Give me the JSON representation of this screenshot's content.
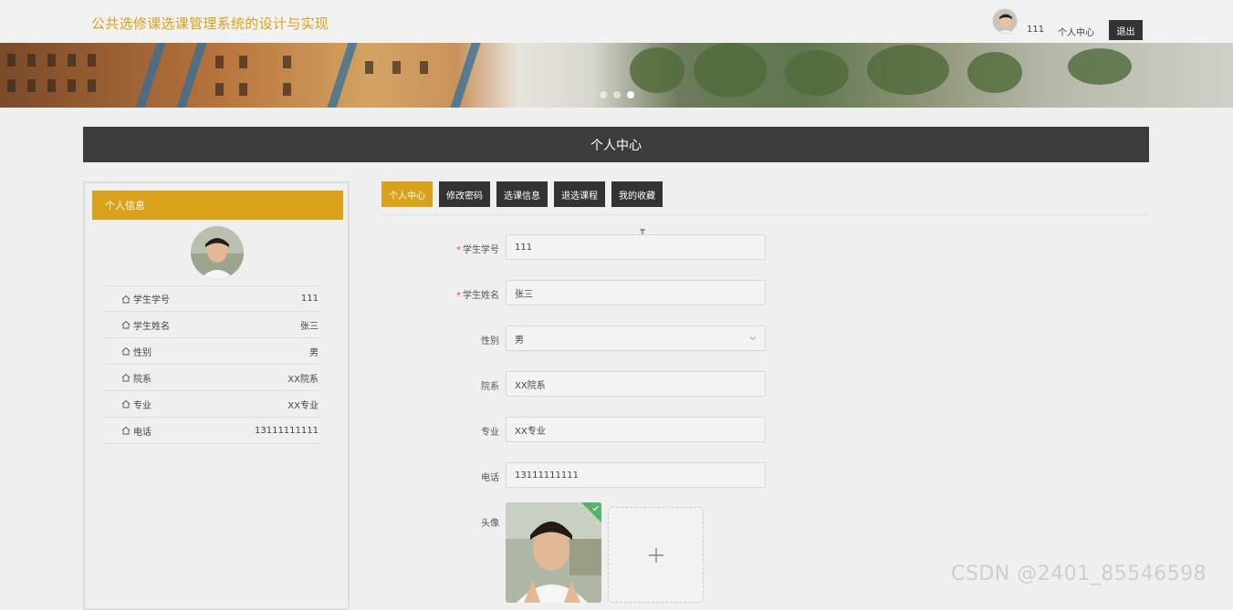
{
  "header": {
    "site_title": "公共选修课选课管理系统的设计与实现",
    "username": "111",
    "profile_link": "个人中心",
    "logout_label": "退出"
  },
  "banner": {
    "slide_count": 3,
    "active_slide": 3
  },
  "page_title": "个人中心",
  "sidebar": {
    "heading": "个人信息",
    "items": [
      {
        "label": "学生学号",
        "value": "111",
        "icon": "home-icon"
      },
      {
        "label": "学生姓名",
        "value": "张三",
        "icon": "home-icon"
      },
      {
        "label": "性别",
        "value": "男",
        "icon": "home-icon"
      },
      {
        "label": "院系",
        "value": "XX院系",
        "icon": "home-icon"
      },
      {
        "label": "专业",
        "value": "XX专业",
        "icon": "home-icon"
      },
      {
        "label": "电话",
        "value": "13111111111",
        "icon": "home-icon"
      }
    ]
  },
  "tabs": [
    {
      "label": "个人中心",
      "active": true
    },
    {
      "label": "修改密码",
      "active": false
    },
    {
      "label": "选课信息",
      "active": false
    },
    {
      "label": "退选课程",
      "active": false
    },
    {
      "label": "我的收藏",
      "active": false
    }
  ],
  "form": {
    "student_id": {
      "label": "学生学号",
      "value": "111",
      "required": true
    },
    "student_name": {
      "label": "学生姓名",
      "value": "张三",
      "required": true
    },
    "gender": {
      "label": "性别",
      "value": "男"
    },
    "department": {
      "label": "院系",
      "value": "XX院系"
    },
    "major": {
      "label": "专业",
      "value": "XX专业"
    },
    "phone": {
      "label": "电话",
      "value": "13111111111"
    },
    "avatar": {
      "label": "头像"
    }
  },
  "colors": {
    "accent": "#d9a21a",
    "dark": "#333333",
    "title_bar": "#3c3c3c",
    "success": "#55b36d"
  },
  "watermark": "CSDN @2401_85546598"
}
